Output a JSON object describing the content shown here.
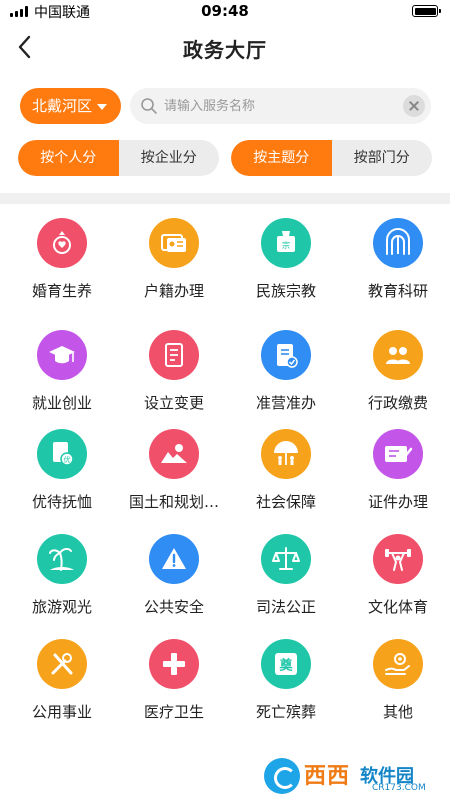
{
  "status_bar": {
    "carrier": "中国联通",
    "time": "09:48"
  },
  "nav": {
    "title": "政务大厅",
    "back_icon": "chevron-left-icon"
  },
  "search": {
    "district": "北戴河区",
    "placeholder": "请输入服务名称",
    "value": ""
  },
  "segments": {
    "left": [
      {
        "label": "按个人分",
        "active": true
      },
      {
        "label": "按企业分",
        "active": false
      }
    ],
    "right": [
      {
        "label": "按主题分",
        "active": true
      },
      {
        "label": "按部门分",
        "active": false
      }
    ]
  },
  "colors": {
    "accent": "#ff7a0f"
  },
  "services": [
    {
      "label": "婚育生养",
      "icon": "marriage-icon",
      "color": "#f0506a"
    },
    {
      "label": "户籍办理",
      "icon": "id-card-icon",
      "color": "#f7a21b"
    },
    {
      "label": "民族宗教",
      "icon": "religion-icon",
      "color": "#1fc7a8"
    },
    {
      "label": "教育科研",
      "icon": "education-icon",
      "color": "#2f8df3"
    },
    {
      "label": "就业创业",
      "icon": "graduation-cap-icon",
      "color": "#c356e8"
    },
    {
      "label": "设立变更",
      "icon": "document-icon",
      "color": "#f0506a"
    },
    {
      "label": "准营准办",
      "icon": "document-check-icon",
      "color": "#2f8df3"
    },
    {
      "label": "行政缴费",
      "icon": "people-icon",
      "color": "#f7a21b"
    },
    {
      "label": "优待抚恤",
      "icon": "certificate-icon",
      "color": "#1fc7a8"
    },
    {
      "label": "国土和规划…",
      "icon": "land-icon",
      "color": "#f0506a"
    },
    {
      "label": "社会保障",
      "icon": "umbrella-family-icon",
      "color": "#f7a21b"
    },
    {
      "label": "证件办理",
      "icon": "card-pen-icon",
      "color": "#c356e8"
    },
    {
      "label": "旅游观光",
      "icon": "palm-island-icon",
      "color": "#1fc7a8"
    },
    {
      "label": "公共安全",
      "icon": "warning-icon",
      "color": "#2f8df3"
    },
    {
      "label": "司法公正",
      "icon": "scales-icon",
      "color": "#1fc7a8"
    },
    {
      "label": "文化体育",
      "icon": "weightlifting-icon",
      "color": "#f0506a"
    },
    {
      "label": "公用事业",
      "icon": "tools-icon",
      "color": "#f7a21b"
    },
    {
      "label": "医疗卫生",
      "icon": "medical-cross-icon",
      "color": "#f0506a"
    },
    {
      "label": "死亡殡葬",
      "icon": "funeral-icon",
      "color": "#1fc7a8",
      "glyph": "奠"
    },
    {
      "label": "其他",
      "icon": "hand-gear-icon",
      "color": "#f7a21b"
    }
  ],
  "watermark": {
    "logo": "西西",
    "name": "软件园",
    "url": "CR173.COM"
  }
}
